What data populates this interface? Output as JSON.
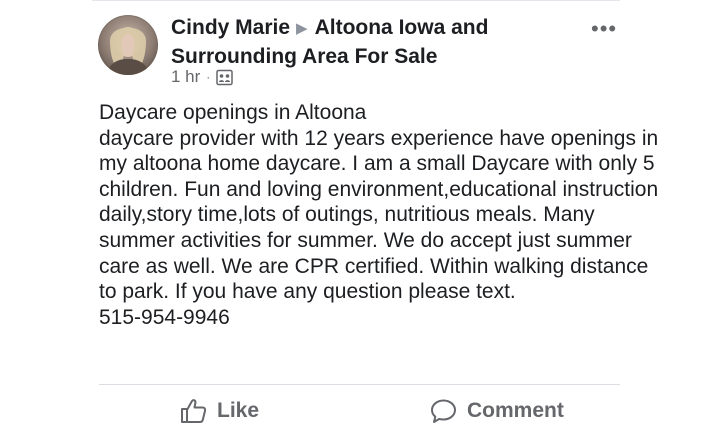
{
  "post": {
    "author": "Cindy Marie",
    "group": "Altoona Iowa and Surrounding Area For Sale",
    "time": "1 hr",
    "meta_separator": "·",
    "icons": {
      "avatar": "profile-photo",
      "privacy": "group-members-icon",
      "more": "more-options-icon",
      "like": "thumbs-up-icon",
      "comment": "comment-bubble-icon"
    },
    "body": "Daycare openings in Altoona\ndaycare provider with 12 years experience have openings in my altoona home daycare. I am a small Daycare with only 5 children. Fun and loving environment,educational instruction daily,story time,lots of outings, nutritious meals.  Many summer activities for summer. We do accept just summer care as well. We are CPR certified. Within walking distance to park. If you have any question please text.\n515-954-9946",
    "more_label": "•••"
  },
  "actions": {
    "like_label": "Like",
    "comment_label": "Comment"
  },
  "colors": {
    "text": "#1c1e21",
    "secondary": "#65676b",
    "divider": "#dadde1"
  }
}
